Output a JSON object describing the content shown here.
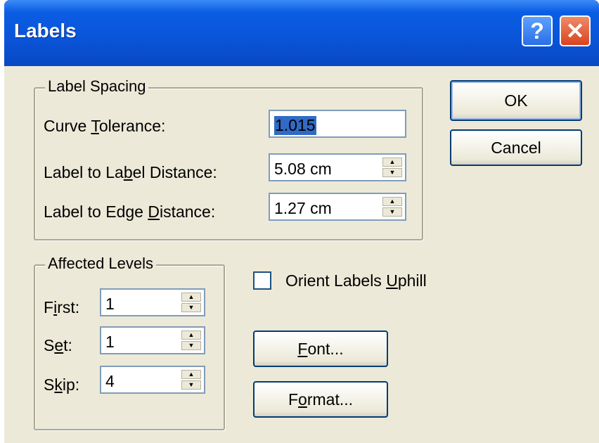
{
  "window": {
    "title": "Labels"
  },
  "titlebar_buttons": {
    "help": "?",
    "close": "✕"
  },
  "label_spacing": {
    "legend": "Label Spacing",
    "curve_tolerance": {
      "label_a": "Curve ",
      "label_u": "T",
      "label_b": "olerance:",
      "value": "1.015"
    },
    "label_distance": {
      "label_a": "Label to La",
      "label_u": "b",
      "label_b": "el Distance:",
      "value": "5.08 cm"
    },
    "edge_distance": {
      "label_a": "Label to Edge ",
      "label_u": "D",
      "label_b": "istance:",
      "value": "1.27 cm"
    }
  },
  "affected_levels": {
    "legend": "Affected Levels",
    "first": {
      "label_a": "F",
      "label_u": "i",
      "label_b": "rst:",
      "value": "1"
    },
    "set": {
      "label_a": "S",
      "label_u": "e",
      "label_b": "t:",
      "value": "1"
    },
    "skip": {
      "label_a": "S",
      "label_u": "k",
      "label_b": "ip:",
      "value": "4"
    }
  },
  "orient_uphill": {
    "label_a": "Orient Labels ",
    "label_u": "U",
    "label_b": "phill",
    "checked": false
  },
  "buttons": {
    "ok": "OK",
    "cancel": "Cancel",
    "font": {
      "a": "",
      "u": "F",
      "b": "ont..."
    },
    "format": {
      "a": "F",
      "u": "o",
      "b": "rmat..."
    }
  }
}
